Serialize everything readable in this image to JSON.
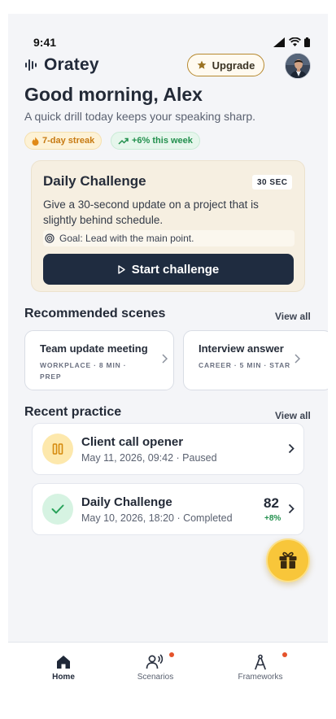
{
  "status": {
    "time": "9:41"
  },
  "app": {
    "name": "Oratey",
    "upgrade_label": "Upgrade"
  },
  "hero": {
    "greeting": "Good morning, Alex",
    "subtitle": "A quick drill today keeps your speaking sharp.",
    "streak": "7-day streak",
    "trend": "+6% this week"
  },
  "challenge": {
    "title": "Daily Challenge",
    "badge": "30 SEC",
    "description": "Give a 30-second update on a project that is slightly behind schedule.",
    "goal": "Goal: Lead with the main point.",
    "cta": "Start challenge"
  },
  "scenes": {
    "title": "Recommended scenes",
    "view_all": "View all",
    "items": [
      {
        "title": "Team update meeting",
        "meta": "WORKPLACE · 8 MIN · PREP"
      },
      {
        "title": "Interview answer",
        "meta": "CAREER · 5 MIN · STAR"
      }
    ]
  },
  "recent": {
    "title": "Recent practice",
    "view_all": "View all",
    "items": [
      {
        "title": "Client call opener",
        "subtitle": "May 11, 2026, 09:42 · Paused",
        "icon": "pause-icon"
      },
      {
        "title": "Daily Challenge",
        "subtitle": "May 10, 2026, 18:20 · Completed",
        "icon": "check-icon",
        "score": "82",
        "delta": "+8%"
      }
    ]
  },
  "nav": {
    "items": [
      {
        "label": "Home",
        "icon": "home-icon",
        "active": true
      },
      {
        "label": "Scenarios",
        "icon": "scenarios-icon",
        "badge": true
      },
      {
        "label": "Frameworks",
        "icon": "frameworks-icon",
        "badge": true
      }
    ]
  },
  "colors": {
    "accent": "#1f2c40",
    "gold": "#b6892f",
    "streak": "#c77a12",
    "positive": "#23904e",
    "badge_dot": "#e5532b",
    "gift": "#f8c63a"
  }
}
